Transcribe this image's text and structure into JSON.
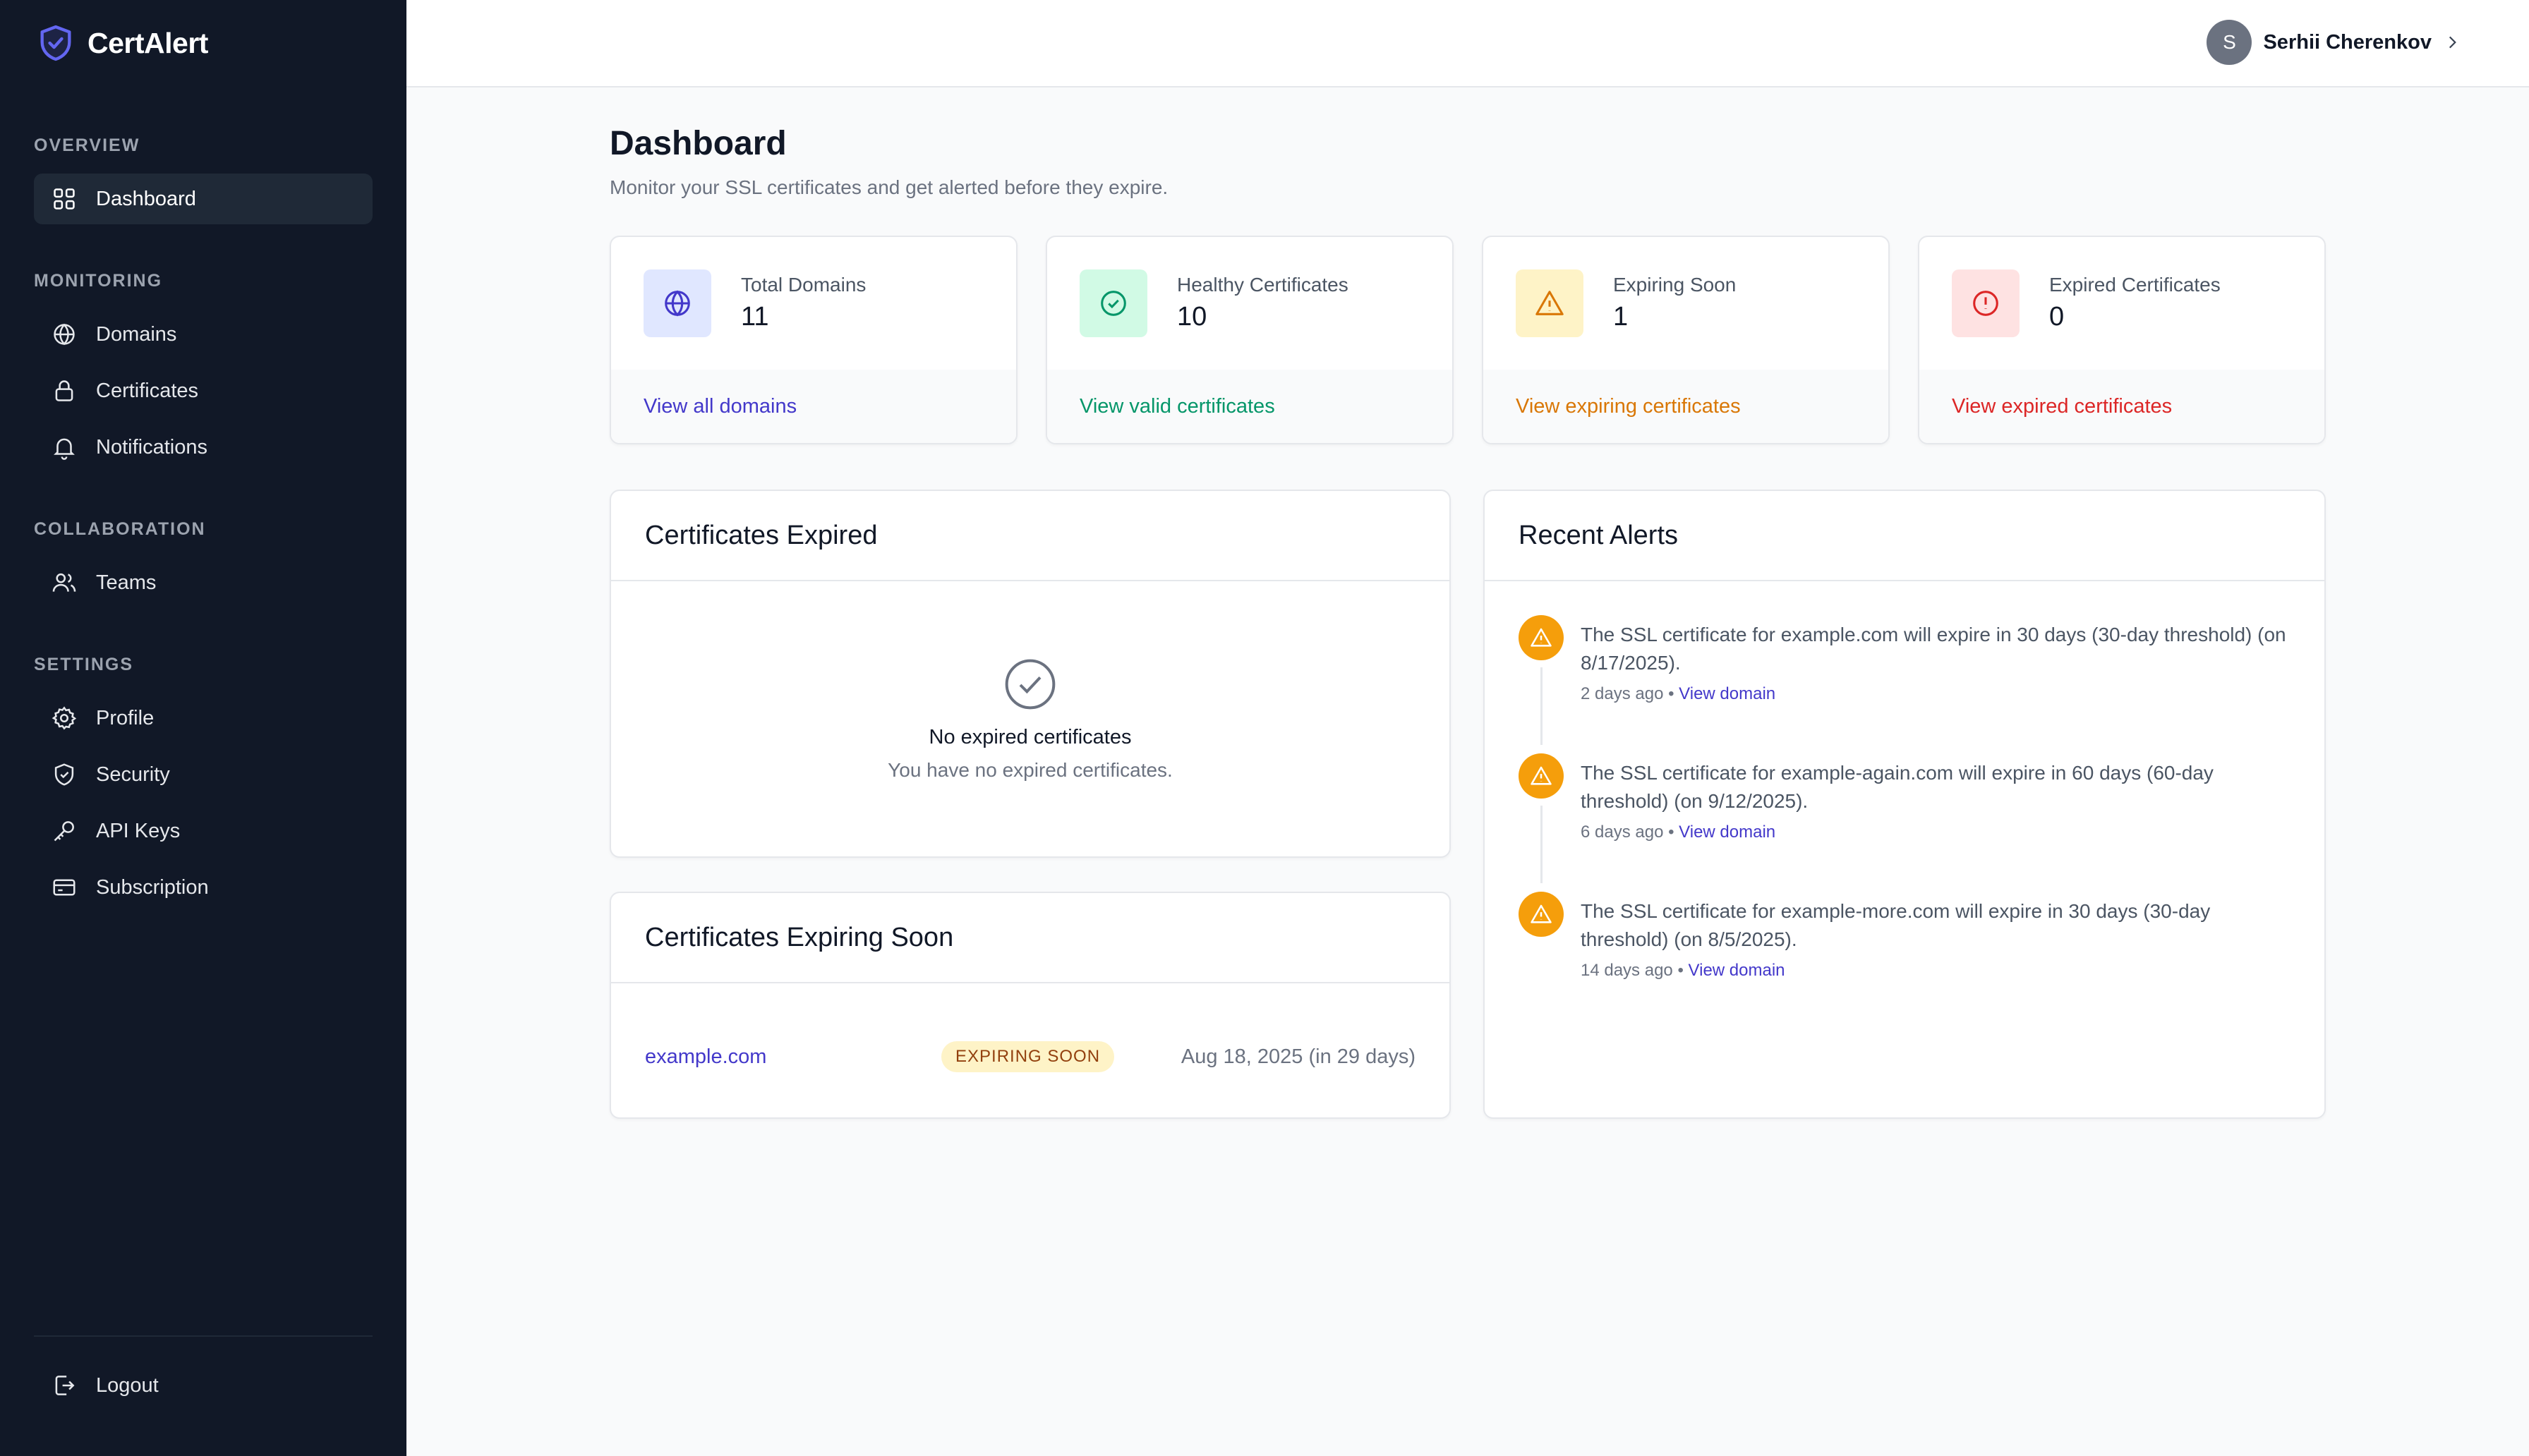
{
  "app": {
    "name": "CertAlert"
  },
  "sidebar": {
    "sections": [
      {
        "title": "OVERVIEW"
      },
      {
        "title": "MONITORING"
      },
      {
        "title": "COLLABORATION"
      },
      {
        "title": "SETTINGS"
      }
    ],
    "items": {
      "dashboard": "Dashboard",
      "domains": "Domains",
      "certificates": "Certificates",
      "notifications": "Notifications",
      "teams": "Teams",
      "profile": "Profile",
      "security": "Security",
      "api_keys": "API Keys",
      "subscription": "Subscription",
      "logout": "Logout"
    }
  },
  "header": {
    "user_initial": "S",
    "user_name": "Serhii Cherenkov"
  },
  "page": {
    "title": "Dashboard",
    "subtitle": "Monitor your SSL certificates and get alerted before they expire."
  },
  "stats": [
    {
      "label": "Total Domains",
      "value": "11",
      "link": "View all domains",
      "color": "#4338ca",
      "bg": "#e0e7ff",
      "icon": "globe-icon"
    },
    {
      "label": "Healthy Certificates",
      "value": "10",
      "link": "View valid certificates",
      "color": "#059669",
      "bg": "#d1fae5",
      "icon": "check-circle-icon"
    },
    {
      "label": "Expiring Soon",
      "value": "1",
      "link": "View expiring certificates",
      "color": "#d97706",
      "bg": "#fef3c7",
      "icon": "warning-icon"
    },
    {
      "label": "Expired Certificates",
      "value": "0",
      "link": "View expired certificates",
      "color": "#dc2626",
      "bg": "#fee2e2",
      "icon": "alert-circle-icon"
    }
  ],
  "expired_panel": {
    "title": "Certificates Expired",
    "empty_title": "No expired certificates",
    "empty_sub": "You have no expired certificates."
  },
  "expiring_panel": {
    "title": "Certificates Expiring Soon",
    "rows": [
      {
        "domain": "example.com",
        "badge": "EXPIRING SOON",
        "date": "Aug 18, 2025 (in 29 days)"
      }
    ]
  },
  "alerts_panel": {
    "title": "Recent Alerts",
    "items": [
      {
        "text": "The SSL certificate for example.com will expire in 30 days (30-day threshold) (on 8/17/2025).",
        "time": "2 days ago",
        "link": "View domain"
      },
      {
        "text": "The SSL certificate for example-again.com will expire in 60 days (60-day threshold) (on 9/12/2025).",
        "time": "6 days ago",
        "link": "View domain"
      },
      {
        "text": "The SSL certificate for example-more.com will expire in 30 days (30-day threshold) (on 8/5/2025).",
        "time": "14 days ago",
        "link": "View domain"
      }
    ]
  },
  "colors": {
    "sidebar_bg": "#111827",
    "accent": "#4338ca",
    "warning": "#f59e0b"
  }
}
